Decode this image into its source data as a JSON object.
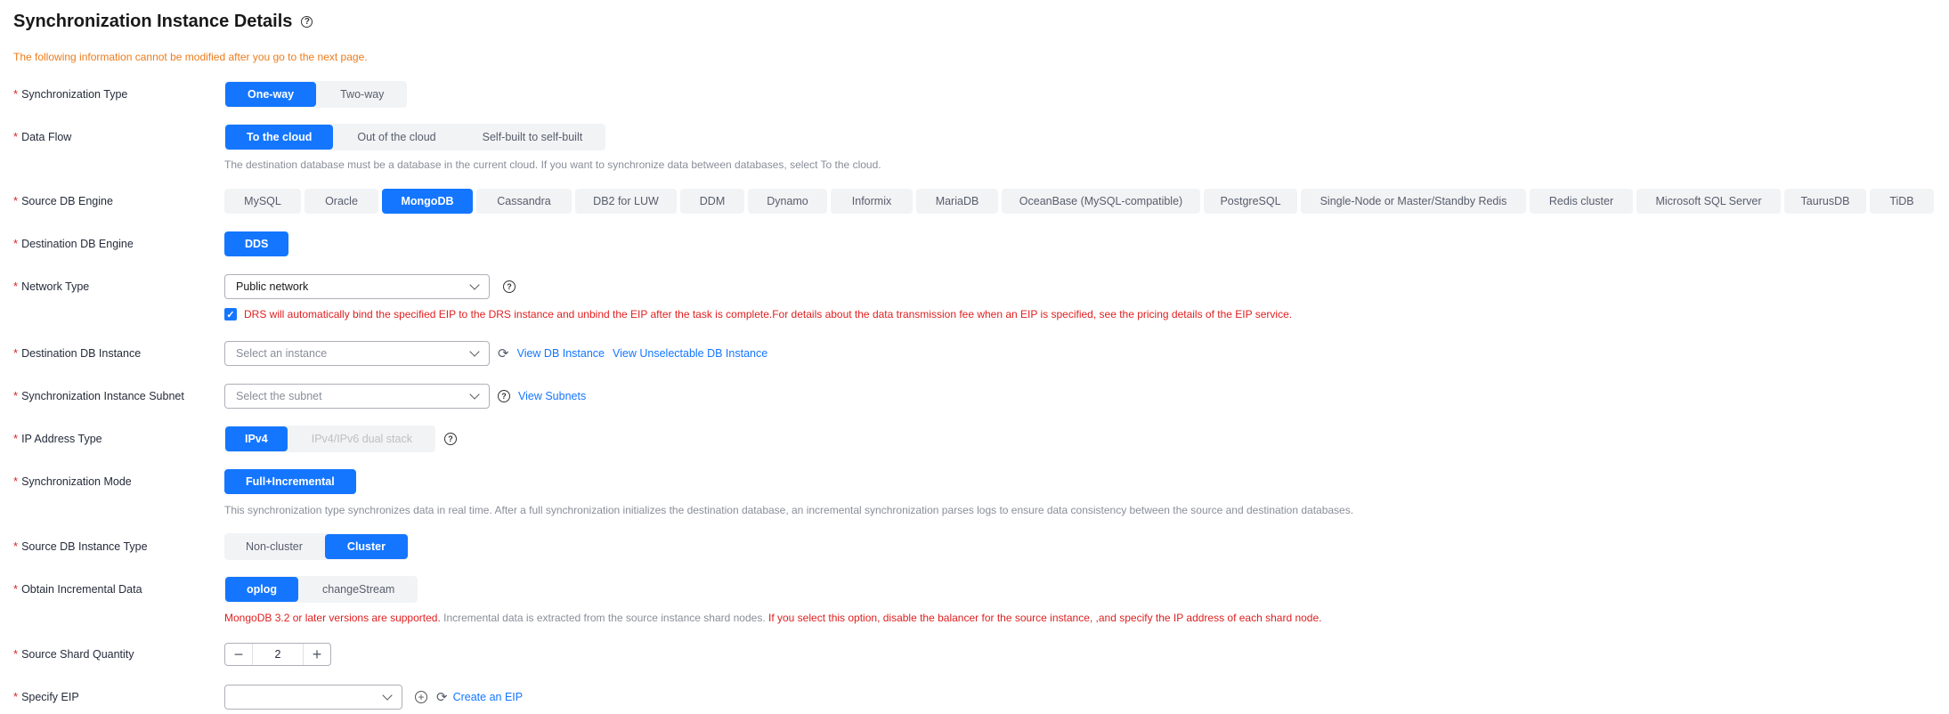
{
  "page": {
    "title": "Synchronization Instance Details",
    "warning": "The following information cannot be modified after you go to the next page."
  },
  "sync_type": {
    "label": "Synchronization Type",
    "options": [
      "One-way",
      "Two-way"
    ],
    "selected": "One-way"
  },
  "data_flow": {
    "label": "Data Flow",
    "options": [
      "To the cloud",
      "Out of the cloud",
      "Self-built to self-built"
    ],
    "selected": "To the cloud",
    "hint": "The destination database must be a database in the current cloud. If you want to synchronize data between databases, select To the cloud."
  },
  "source_engine": {
    "label": "Source DB Engine",
    "options": [
      "MySQL",
      "Oracle",
      "MongoDB",
      "Cassandra",
      "DB2 for LUW",
      "DDM",
      "Dynamo",
      "Informix",
      "MariaDB",
      "OceanBase (MySQL-compatible)",
      "PostgreSQL",
      "Single-Node or Master/Standby Redis",
      "Redis cluster",
      "Microsoft SQL Server",
      "TaurusDB",
      "TiDB"
    ],
    "selected": "MongoDB"
  },
  "dest_engine": {
    "label": "Destination DB Engine",
    "value": "DDS"
  },
  "network": {
    "label": "Network Type",
    "value": "Public network",
    "checkbox_text": "DRS will automatically bind the specified EIP to the DRS instance and unbind the EIP after the task is complete.For details about the data transmission fee when an EIP is specified, see the pricing details of the EIP service."
  },
  "dest_instance": {
    "label": "Destination DB Instance",
    "placeholder": "Select an instance",
    "link1": "View DB Instance",
    "link2": "View Unselectable DB Instance"
  },
  "subnet": {
    "label": "Synchronization Instance Subnet",
    "placeholder": "Select the subnet",
    "link": "View Subnets"
  },
  "ip_type": {
    "label": "IP Address Type",
    "options": [
      "IPv4",
      "IPv4/IPv6 dual stack"
    ],
    "selected": "IPv4"
  },
  "sync_mode": {
    "label": "Synchronization Mode",
    "value": "Full+Incremental",
    "hint": "This synchronization type synchronizes data in real time. After a full synchronization initializes the destination database, an incremental synchronization parses logs to ensure data consistency between the source and destination databases."
  },
  "src_instance_type": {
    "label": "Source DB Instance Type",
    "options": [
      "Non-cluster",
      "Cluster"
    ],
    "selected": "Cluster"
  },
  "incremental": {
    "label": "Obtain Incremental Data",
    "options": [
      "oplog",
      "changeStream"
    ],
    "selected": "oplog",
    "hint_red1": "MongoDB 3.2 or later versions are supported.",
    "hint_gray": " Incremental data is extracted from the source instance shard nodes. ",
    "hint_red2": "If you select this option, disable the balancer for the source instance, ,and specify the IP address of each shard node."
  },
  "shard_qty": {
    "label": "Source Shard Quantity",
    "value": "2"
  },
  "eip": {
    "label": "Specify EIP",
    "link": "Create an EIP"
  },
  "icons": {
    "help": "help-circle-icon",
    "chevron": "chevron-down-icon",
    "refresh": "refresh-icon",
    "add": "add-circle-icon",
    "check": "check-icon"
  },
  "colors": {
    "primary": "#1476ff",
    "warning": "#ec7c1b",
    "error": "#e02020"
  }
}
